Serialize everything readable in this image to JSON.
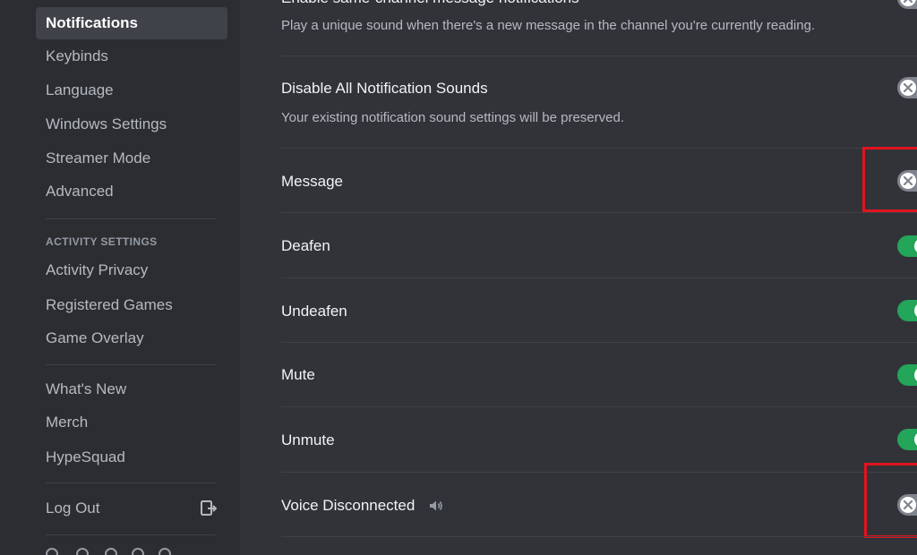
{
  "sidebar": {
    "items": [
      {
        "label": "Notifications"
      },
      {
        "label": "Keybinds"
      },
      {
        "label": "Language"
      },
      {
        "label": "Windows Settings"
      },
      {
        "label": "Streamer Mode"
      },
      {
        "label": "Advanced"
      }
    ],
    "activity_header": "ACTIVITY SETTINGS",
    "activity_items": [
      {
        "label": "Activity Privacy"
      },
      {
        "label": "Registered Games"
      },
      {
        "label": "Game Overlay"
      }
    ],
    "misc_items": [
      {
        "label": "What's New"
      },
      {
        "label": "Merch"
      },
      {
        "label": "HypeSquad"
      }
    ],
    "logout_label": "Log Out",
    "logout_icon": "logout-icon",
    "social_icons": [
      "x-icon",
      "instagram-icon",
      "facebook-icon",
      "youtube-icon",
      "tiktok-icon"
    ]
  },
  "settings": {
    "same_channel_title": "Enable same-channel message notifications",
    "same_channel_desc": "Play a unique sound when there's a new message in the channel you're currently reading.",
    "same_channel_enabled": false,
    "disable_all_title": "Disable All Notification Sounds",
    "disable_all_desc": "Your existing notification sound settings will be preserved.",
    "disable_all_enabled": false,
    "sounds": [
      {
        "label": "Message",
        "enabled": false
      },
      {
        "label": "Deafen",
        "enabled": true
      },
      {
        "label": "Undeafen",
        "enabled": true
      },
      {
        "label": "Mute",
        "enabled": true
      },
      {
        "label": "Unmute",
        "enabled": true
      },
      {
        "label": "Voice Disconnected",
        "enabled": false
      }
    ],
    "voice_disconnected_icon": "speaker-icon"
  },
  "colors": {
    "toggle_on": "#23a55a",
    "toggle_off": "#80848e",
    "highlight": "#e0141e",
    "background": "#313338",
    "sidebar": "#2b2d31"
  }
}
